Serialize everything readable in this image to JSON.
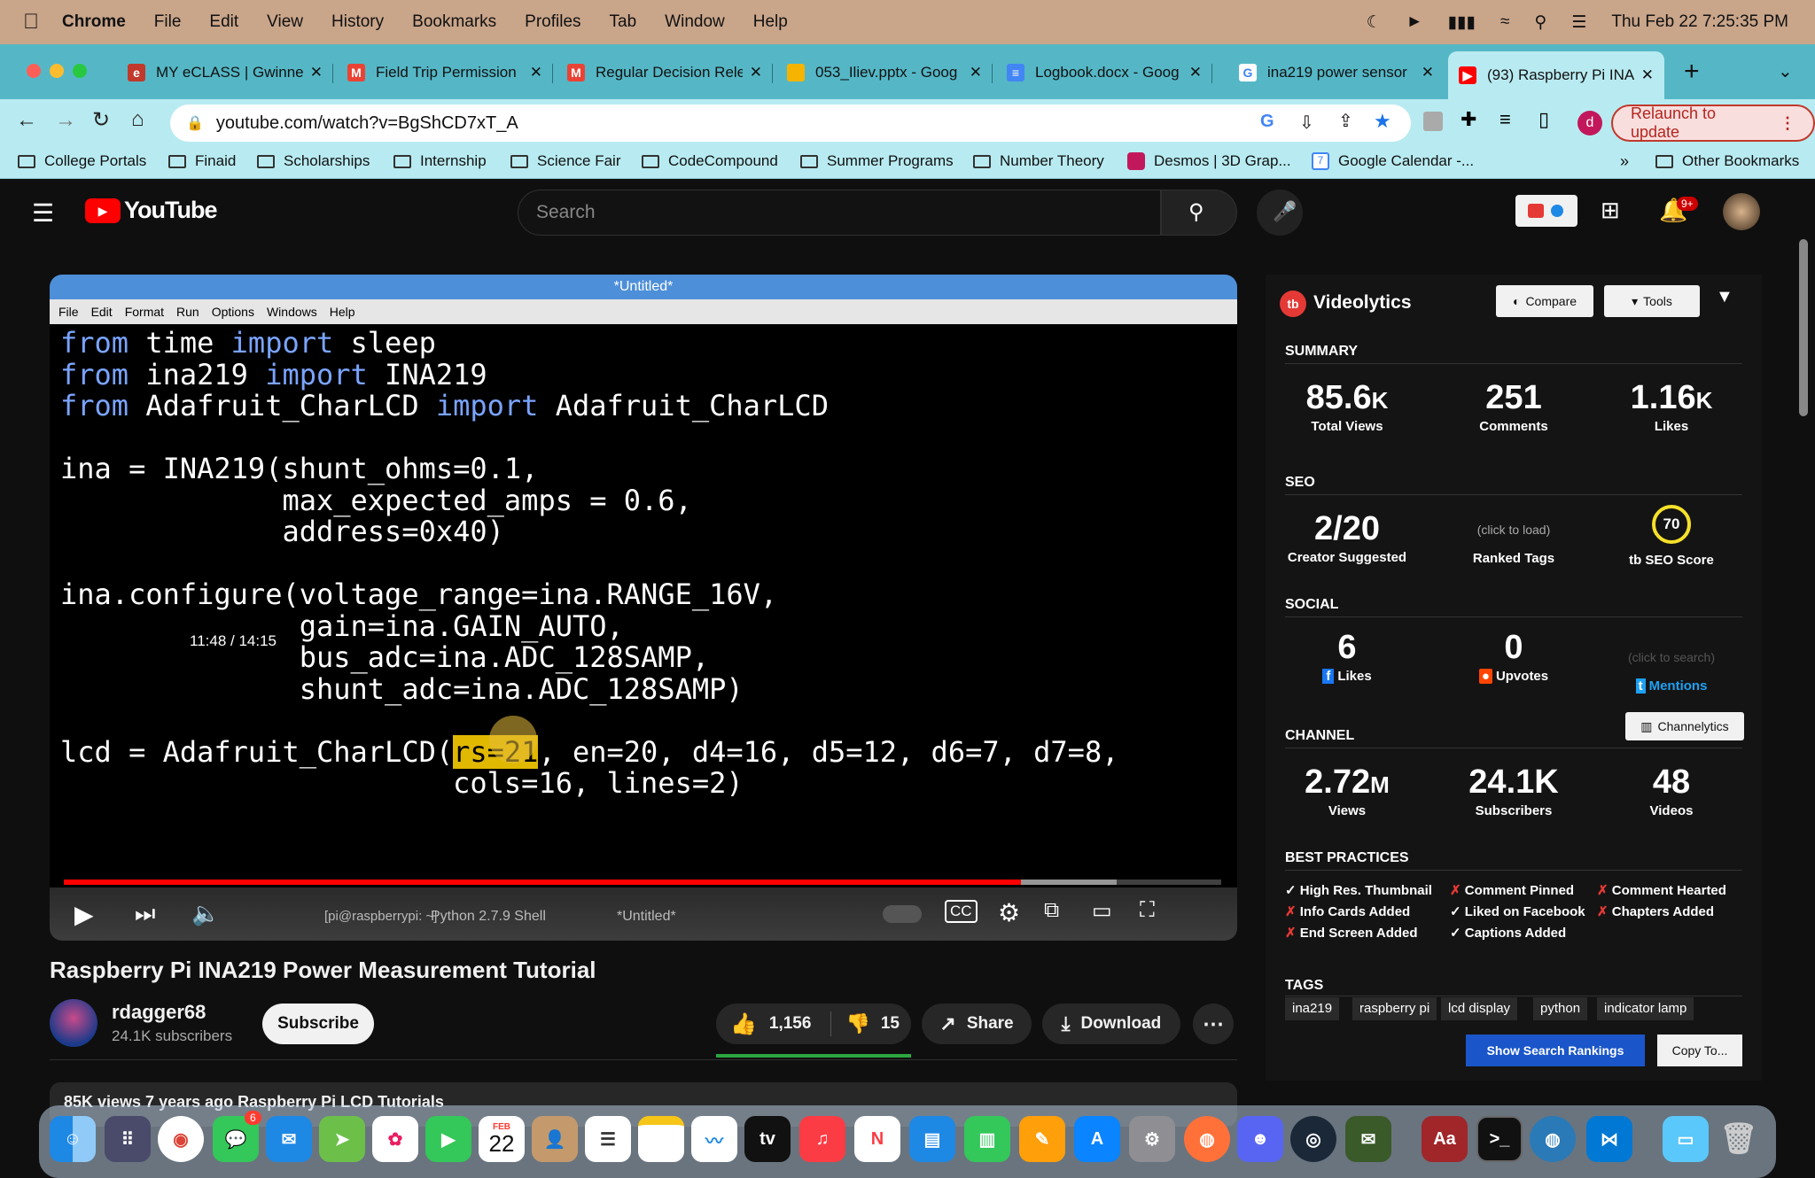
{
  "menubar": {
    "app": "Chrome",
    "items": [
      "File",
      "Edit",
      "View",
      "History",
      "Bookmarks",
      "Profiles",
      "Tab",
      "Window",
      "Help"
    ],
    "datetime": "Thu Feb 22  7:25:35 PM"
  },
  "tabs": [
    {
      "title": "MY eCLASS | Gwinnett",
      "favicon_color": "#c0392b"
    },
    {
      "title": "Field Trip Permission",
      "favicon_color": "#ea4335"
    },
    {
      "title": "Regular Decision Rele",
      "favicon_color": "#ea4335"
    },
    {
      "title": "053_Iliev.pptx - Goog",
      "favicon_color": "#f4b400"
    },
    {
      "title": "Logbook.docx - Goog",
      "favicon_color": "#4285f4"
    },
    {
      "title": "ina219 power sensor",
      "favicon_color": "#4285f4"
    },
    {
      "title": "(93) Raspberry Pi INA",
      "favicon_color": "#ff0000"
    }
  ],
  "toolbar": {
    "url": "youtube.com/watch?v=BgShCD7xT_A",
    "relaunch": "Relaunch to update",
    "profile_initial": "d"
  },
  "bookmarks": [
    "College Portals",
    "Finaid",
    "Scholarships",
    "Internship",
    "Science Fair",
    "CodeCompound",
    "Summer Programs",
    "Number Theory",
    "Desmos | 3D Grap...",
    "Google Calendar -...",
    "»",
    "Other Bookmarks"
  ],
  "youtube": {
    "logo": "YouTube",
    "search_placeholder": "Search",
    "notif_count": "9+"
  },
  "video": {
    "idle_title": "*Untitled*",
    "idle_menu": [
      "File",
      "Edit",
      "Format",
      "Run",
      "Options",
      "Windows",
      "Help"
    ],
    "time": "11:48 / 14:15",
    "taskbar": [
      "[pi@raspberrypi: ~]",
      "Python 2.7.9 Shell",
      "*Untitled*"
    ],
    "progress": 0.827,
    "buffered": 0.91
  },
  "meta": {
    "title": "Raspberry Pi INA219 Power Measurement Tutorial",
    "channel": "rdagger68",
    "subscribers": "24.1K subscribers",
    "subscribe": "Subscribe",
    "likes": "1,156",
    "dislikes": "15",
    "share": "Share",
    "download": "Download",
    "views_date": "85K views  7 years ago  Raspberry Pi LCD Tutorials"
  },
  "videolytics": {
    "brand": "Videolytics",
    "compare": "Compare",
    "tools": "Tools",
    "summary_label": "SUMMARY",
    "summary": [
      {
        "num": "85.6",
        "suffix": "K",
        "label": "Total Views"
      },
      {
        "num": "251",
        "suffix": "",
        "label": "Comments"
      },
      {
        "num": "1.16",
        "suffix": "K",
        "label": "Likes"
      }
    ],
    "seo_label": "SEO",
    "seo": {
      "creator": "2/20",
      "creator_label": "Creator Suggested",
      "ranked_hint": "(click to load)",
      "ranked_label": "Ranked Tags",
      "score": "70",
      "score_label": "SEO Score"
    },
    "social_label": "SOCIAL",
    "social": {
      "likes": "6",
      "likes_label": "Likes",
      "upvotes": "0",
      "upvotes_label": "Upvotes",
      "mentions_hint": "(click to search)",
      "mentions_label": "Mentions"
    },
    "channel_label": "CHANNEL",
    "channelytics": "Channelytics",
    "channel": [
      {
        "num": "2.72",
        "suffix": "M",
        "label": "Views"
      },
      {
        "num": "24.1K",
        "suffix": "",
        "label": "Subscribers"
      },
      {
        "num": "48",
        "suffix": "",
        "label": "Videos"
      }
    ],
    "best_label": "BEST PRACTICES",
    "best": [
      {
        "mark": "✓",
        "text": "High Res. Thumbnail",
        "ok": true
      },
      {
        "mark": "✗",
        "text": "Comment Pinned",
        "ok": false
      },
      {
        "mark": "✗",
        "text": "Comment Hearted",
        "ok": false
      },
      {
        "mark": "✗",
        "text": "Info Cards Added",
        "ok": false
      },
      {
        "mark": "✓",
        "text": "Liked on Facebook",
        "ok": true
      },
      {
        "mark": "✗",
        "text": "Chapters Added",
        "ok": false
      },
      {
        "mark": "✗",
        "text": "End Screen Added",
        "ok": false
      },
      {
        "mark": "✓",
        "text": "Captions Added",
        "ok": true
      }
    ],
    "tags_label": "TAGS",
    "tags": [
      "ina219",
      "raspberry pi",
      "lcd display",
      "python",
      "indicator lamp"
    ],
    "show_rankings": "Show Search Rankings",
    "copy_to": "Copy To..."
  },
  "dock": {
    "messages_badge": "6",
    "calendar_month": "FEB",
    "calendar_day": "22",
    "appletv": "tv",
    "dictionary": "Aa"
  }
}
